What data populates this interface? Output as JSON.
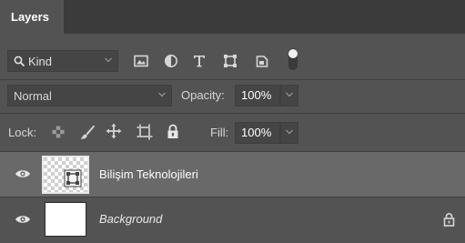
{
  "panel": {
    "tab_label": "Layers"
  },
  "filter": {
    "kind_label": "Kind",
    "type_icons": [
      "image-filter-icon",
      "adjustment-filter-icon",
      "type-filter-icon",
      "shape-filter-icon",
      "smart-object-filter-icon",
      "filter-toggle-icon"
    ]
  },
  "blend": {
    "mode": "Normal",
    "opacity_label": "Opacity:",
    "opacity_value": "100%"
  },
  "lock": {
    "label": "Lock:",
    "fill_label": "Fill:",
    "fill_value": "100%"
  },
  "layers": [
    {
      "name": "Bilişim Teknolojileri",
      "visible": true,
      "selected": true,
      "type": "smart-object"
    },
    {
      "name": "Background",
      "visible": true,
      "selected": false,
      "locked": true
    }
  ],
  "colors": {
    "panel_bg": "#535353",
    "selected_row": "#696969",
    "tab_bar": "#3b3b3b"
  }
}
